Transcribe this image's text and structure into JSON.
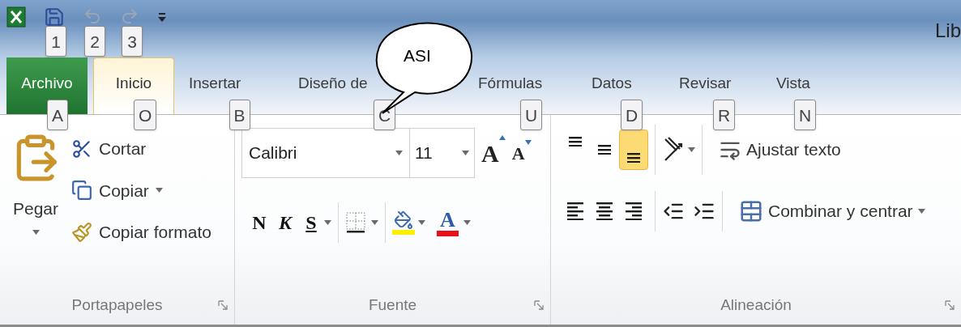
{
  "title_bar": {
    "title": "Lib",
    "key_tips": [
      "1",
      "2",
      "3"
    ]
  },
  "tabs": [
    {
      "label": "Archivo",
      "kind": "file",
      "selected": false,
      "key_tip": "A"
    },
    {
      "label": "Inicio",
      "kind": "tab",
      "selected": true,
      "key_tip": "O"
    },
    {
      "label": "Insertar",
      "kind": "tab",
      "selected": false,
      "key_tip": "B"
    },
    {
      "label": "Diseño de",
      "kind": "tab",
      "selected": false,
      "key_tip": "C"
    },
    {
      "label": "Fórmulas",
      "kind": "tab",
      "selected": false,
      "key_tip": "U"
    },
    {
      "label": "Datos",
      "kind": "tab",
      "selected": false,
      "key_tip": "D"
    },
    {
      "label": "Revisar",
      "kind": "tab",
      "selected": false,
      "key_tip": "R"
    },
    {
      "label": "Vista",
      "kind": "tab",
      "selected": false,
      "key_tip": "N"
    }
  ],
  "callout": {
    "text": "ASI"
  },
  "clipboard": {
    "label": "Portapapeles",
    "paste": "Pegar",
    "actions": [
      {
        "label": "Cortar",
        "kind": "cut",
        "dropdown": false
      },
      {
        "label": "Copiar",
        "kind": "copy",
        "dropdown": true
      },
      {
        "label": "Copiar formato",
        "kind": "format",
        "dropdown": false
      }
    ]
  },
  "font": {
    "label": "Fuente",
    "font_name": "Calibri",
    "font_size": "11",
    "grow": "A",
    "shrink": "A",
    "font_color": "A",
    "styles": [
      {
        "label": "N",
        "kind": "bold"
      },
      {
        "label": "K",
        "kind": "italic"
      },
      {
        "label": "S",
        "kind": "underline"
      }
    ]
  },
  "alignment": {
    "label": "Alineación",
    "wrap": "Ajustar texto",
    "merge": "Combinar y centrar",
    "vertical": [
      {
        "kind": "top",
        "selected": false
      },
      {
        "kind": "middle",
        "selected": false
      },
      {
        "kind": "bottom",
        "selected": true
      }
    ],
    "horizontal": [
      {
        "kind": "left",
        "selected": false
      },
      {
        "kind": "center",
        "selected": false
      },
      {
        "kind": "right",
        "selected": false
      }
    ]
  }
}
